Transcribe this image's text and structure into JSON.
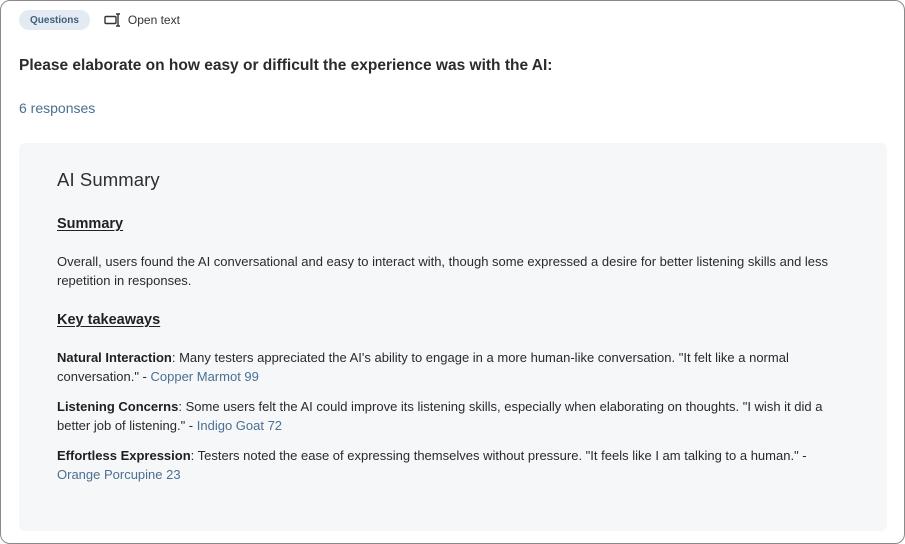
{
  "header": {
    "chip_label": "Questions",
    "question_type": "Open text",
    "question_type_icon": "open-text-icon"
  },
  "question": {
    "text": "Please elaborate on how easy or difficult the experience was with the AI:",
    "responses_label": "6 responses"
  },
  "ai_summary": {
    "title": "AI Summary",
    "summary_heading": "Summary",
    "summary_text": "Overall, users found the AI conversational and easy to interact with, though some expressed a desire for better listening skills and less repetition in responses.",
    "takeaways_heading": "Key takeaways",
    "takeaways": [
      {
        "title": "Natural Interaction",
        "text": ": Many testers appreciated the AI's ability to engage in a more human-like conversation. \"It felt like a normal conversation.\" - ",
        "author": "Copper Marmot 99"
      },
      {
        "title": "Listening Concerns",
        "text": ": Some users felt the AI could improve its listening skills, especially when elaborating on thoughts. \"I wish it did a better job of listening.\" - ",
        "author": "Indigo Goat 72"
      },
      {
        "title": "Effortless Expression",
        "text": ": Testers noted the ease of expressing themselves without pressure. \"It feels like I am talking to a human.\" - ",
        "author": "Orange Porcupine 23"
      }
    ]
  },
  "colors": {
    "chip_bg": "#e3eaf2",
    "link": "#4a6f92",
    "card_bg": "#f6f7f9"
  }
}
